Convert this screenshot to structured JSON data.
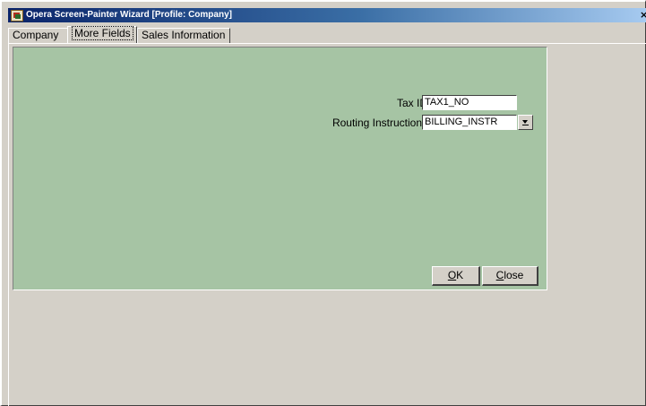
{
  "window": {
    "title": "Opera Screen-Painter Wizard [Profile: Company]",
    "close_symbol": "×"
  },
  "tabs": [
    {
      "label": "Company",
      "active": false
    },
    {
      "label": "More Fields",
      "active": true
    },
    {
      "label": "Sales Information",
      "active": false
    }
  ],
  "form": {
    "background_color": "#a6c4a4",
    "fields": [
      {
        "label": "Tax ID",
        "value": "TAX1_NO"
      },
      {
        "label": "Routing Instructions",
        "value": "BILLING_INSTR",
        "has_dropdown": true
      }
    ]
  },
  "buttons": {
    "ok": {
      "mnemonic": "O",
      "rest": "K"
    },
    "close": {
      "mnemonic": "C",
      "rest": "lose"
    }
  },
  "icons": {
    "app": "opera-app-icon",
    "dropdown": "dropdown-arrow-icon"
  }
}
